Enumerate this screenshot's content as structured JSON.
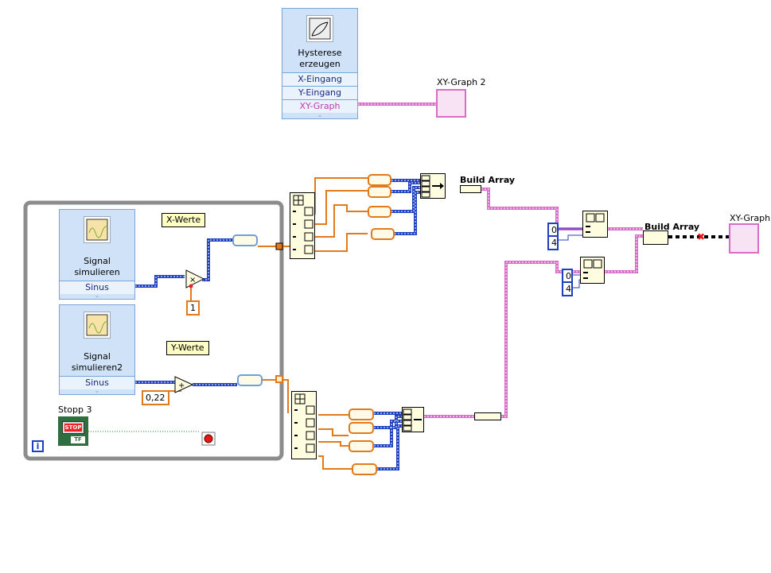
{
  "hysterese_vi": {
    "title_line1": "Hysterese",
    "title_line2": "erzeugen",
    "terminals": [
      "X-Eingang",
      "Y-Eingang",
      "XY-Graph"
    ]
  },
  "sim1": {
    "title_line1": "Signal",
    "title_line2": "simulieren",
    "terminal": "Sinus"
  },
  "sim2": {
    "title_line1": "Signal",
    "title_line2": "simulieren2",
    "terminal": "Sinus"
  },
  "labels": {
    "x_werte": "X-Werte",
    "y_werte": "Y-Werte",
    "stopp": "Stopp 3",
    "stop_button_text": "STOP",
    "stop_tf": "TF",
    "xy_graph2": "XY-Graph 2",
    "xy_graph": "XY-Graph",
    "build_array_1": "Build Array",
    "build_array_2": "Build Array",
    "loop_iteration": "i"
  },
  "constants": {
    "multiply_const": "1",
    "add_const": "0,22",
    "subset1_index": "0",
    "subset1_length": "4",
    "subset2_index": "0",
    "subset2_length": "4"
  },
  "colors": {
    "wire_dynamic": "#1f3fc1",
    "wire_numeric": "#e07a1a",
    "wire_cluster": "#d86cc9",
    "wire_boolean": "#1a8a1a",
    "wire_broken": "#000000",
    "express_vi": "#cfe2f7",
    "while_loop_frame": "#8c8c8c"
  }
}
